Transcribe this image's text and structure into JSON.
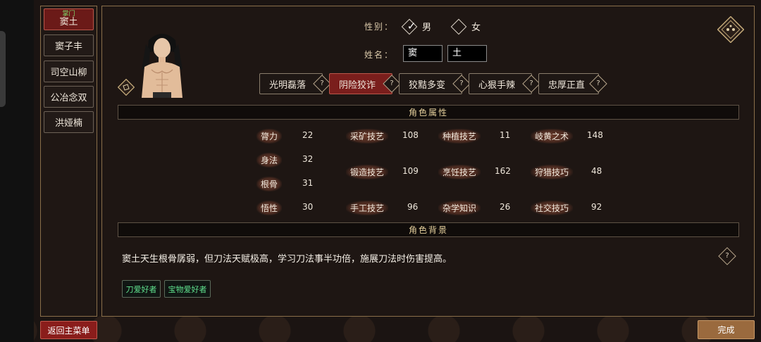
{
  "roster": {
    "items": [
      {
        "tag": "掌门",
        "name": "窦土"
      },
      {
        "name": "窦子丰"
      },
      {
        "name": "司空山柳"
      },
      {
        "name": "公冶念双"
      },
      {
        "name": "洪娅楠"
      }
    ]
  },
  "gender": {
    "label": "性别：",
    "options": [
      "男",
      "女"
    ],
    "selected": "男"
  },
  "name": {
    "label": "姓名：",
    "surname": "窦",
    "given": "土"
  },
  "traits": [
    {
      "label": "光明磊落",
      "help": "?"
    },
    {
      "label": "阴险狡诈",
      "help": "?",
      "selected": true
    },
    {
      "label": "狡黠多变",
      "help": "?"
    },
    {
      "label": "心狠手辣",
      "help": "?"
    },
    {
      "label": "忠厚正直",
      "help": "?"
    }
  ],
  "attributes": {
    "title": "角色属性",
    "stats": [
      {
        "name": "膂力",
        "value": "22"
      },
      {
        "name": "身法",
        "value": "32"
      },
      {
        "name": "根骨",
        "value": "31"
      },
      {
        "name": "悟性",
        "value": "30"
      },
      {
        "name": "采矿技艺",
        "value": "108"
      },
      {
        "name": "锻造技艺",
        "value": "109"
      },
      {
        "name": "手工技艺",
        "value": "96"
      },
      {
        "name": "种植技艺",
        "value": "11"
      },
      {
        "name": "烹饪技艺",
        "value": "162"
      },
      {
        "name": "杂学知识",
        "value": "26"
      },
      {
        "name": "岐黄之术",
        "value": "148"
      },
      {
        "name": "狩猎技巧",
        "value": "48"
      },
      {
        "name": "社交技巧",
        "value": "92"
      }
    ]
  },
  "background": {
    "title": "角色背景",
    "text": "窦土天生根骨孱弱，但刀法天赋极高，学习刀法事半功倍，施展刀法时伤害提高。",
    "help": "?",
    "tags": [
      "刀爱好者",
      "宝物爱好者"
    ]
  },
  "buttons": {
    "back": "返回主菜单",
    "done": "完成"
  },
  "colors": {
    "accent_red": "#7a1e1c",
    "gold": "#8a6f4a",
    "tag_green": "#5fe08d",
    "sect_green": "#7dd96b",
    "done_brown": "#9a6a3e"
  }
}
